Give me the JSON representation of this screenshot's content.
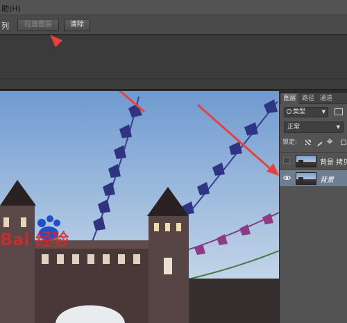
{
  "menubar": {
    "help_menu": "助(H)"
  },
  "options": {
    "prefix_label": "列",
    "flatten_button": "拉直图层",
    "erase_button": "清除"
  },
  "layers_panel": {
    "tabs": [
      "图层",
      "路径",
      "通道"
    ],
    "filter_kind": "类型",
    "blend_mode": "正常",
    "lock_label": "锁定:",
    "layers": [
      {
        "name": "背景 拷贝",
        "visible": false,
        "selected": false
      },
      {
        "name": "背景",
        "visible": true,
        "selected": true
      }
    ]
  },
  "photo": {
    "watermark_text": "Bai  经验"
  },
  "colors": {
    "annotation_arrow": "#e8413a",
    "selected_layer": "#6d7e91",
    "sky_top": "#6f9ad0",
    "sky_bottom": "#d6e2ee"
  },
  "icons": [
    "search-icon",
    "image-filter-icon",
    "lock-transparent-icon",
    "lock-brush-icon",
    "lock-move-icon",
    "lock-all-icon",
    "eye-icon"
  ]
}
